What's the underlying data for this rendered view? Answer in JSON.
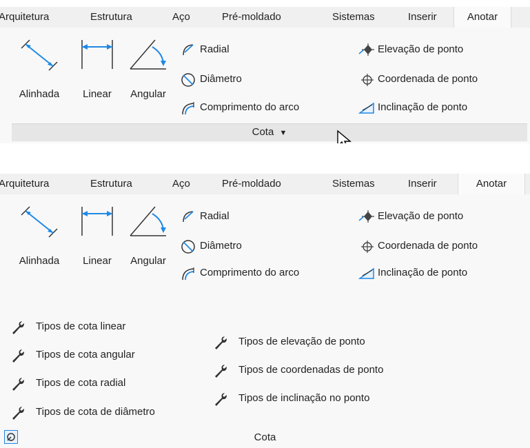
{
  "tabs": [
    "Arquitetura",
    "Estrutura",
    "Aço",
    "Pré-moldado",
    "Sistemas",
    "Inserir",
    "Anotar"
  ],
  "active_tab": "Anotar",
  "big_buttons": [
    "Alinhada",
    "Linear",
    "Angular"
  ],
  "small_left": [
    "Radial",
    "Diâmetro",
    "Comprimento do arco"
  ],
  "small_right": [
    "Elevação de ponto",
    "Coordenada de ponto",
    "Inclinação de ponto"
  ],
  "panel_title": "Cota",
  "dropdown_arrow": "▼",
  "expanded": {
    "types_left": [
      "Tipos de cota linear",
      "Tipos de cota angular",
      "Tipos de cota radial",
      "Tipos de cota de diâmetro"
    ],
    "types_right": [
      "Tipos de elevação de ponto",
      "Tipos de coordenadas de ponto",
      "Tipos de inclinação no ponto"
    ],
    "panel_title": "Cota"
  },
  "colors": {
    "accent": "#1e88e5",
    "tab_bg": "#f0f0f0",
    "ribbon_bg": "#f8f8f8",
    "panel_bar": "#e6e6e6"
  }
}
